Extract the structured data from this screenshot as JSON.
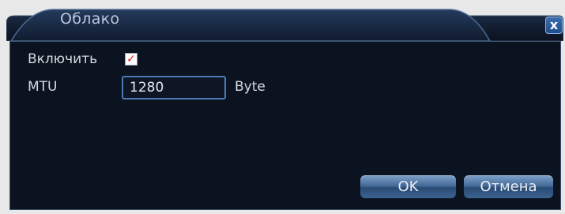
{
  "dialog": {
    "title": "Облако",
    "close_label": "x"
  },
  "form": {
    "enable_label": "Включить",
    "enable_checked": true,
    "mtu_label": "MTU",
    "mtu_value": "1280",
    "mtu_unit": "Byte"
  },
  "buttons": {
    "ok_label": "OK",
    "cancel_label": "Отмена"
  },
  "colors": {
    "dialog_background": "#0b1220",
    "titlebar_blue": "#2c5f9c",
    "check_mark": "#e01b1b",
    "input_border": "#4a79b7"
  },
  "icons": {
    "checkbox": "check-mark-icon",
    "close": "close-icon"
  }
}
